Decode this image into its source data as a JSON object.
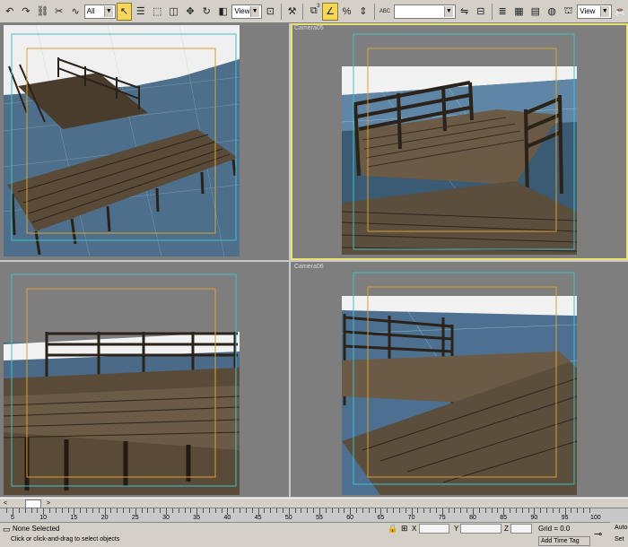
{
  "toolbar": {
    "selection_filter": "All",
    "ref_coord_1": "View",
    "ref_coord_2": "View",
    "named_selection": "",
    "snap_counter": "3",
    "abc_label": "ABC"
  },
  "viewports": {
    "top_left": {
      "label": ""
    },
    "top_right": {
      "label": "Camera05"
    },
    "bottom_left": {
      "label": ""
    },
    "bottom_right": {
      "label": "Camera06"
    }
  },
  "scrubber": {
    "frame_display": "",
    "prev_label": "<",
    "next_label": ">"
  },
  "timeline": {
    "ticks": [
      "5",
      "10",
      "15",
      "20",
      "25",
      "30",
      "35",
      "40",
      "45",
      "50",
      "55",
      "60",
      "65",
      "70",
      "75",
      "80",
      "85",
      "90",
      "95",
      "100"
    ]
  },
  "status": {
    "selection": "None Selected",
    "prompt": "Click or click-and-drag to select objects",
    "x_label": "X",
    "y_label": "Y",
    "z_label": "Z",
    "x_value": "",
    "y_value": "",
    "z_value": "",
    "grid": "Grid = 0.0",
    "add_time_tag": "Add Time Tag",
    "auto_key": "Auto",
    "set_key": "Set"
  },
  "colors": {
    "active_viewport": "#e8e070",
    "safe_frame_inner": "#d9a030",
    "safe_frame_outer": "#40c0c8",
    "viewport_bg": "#7e7e7e"
  }
}
